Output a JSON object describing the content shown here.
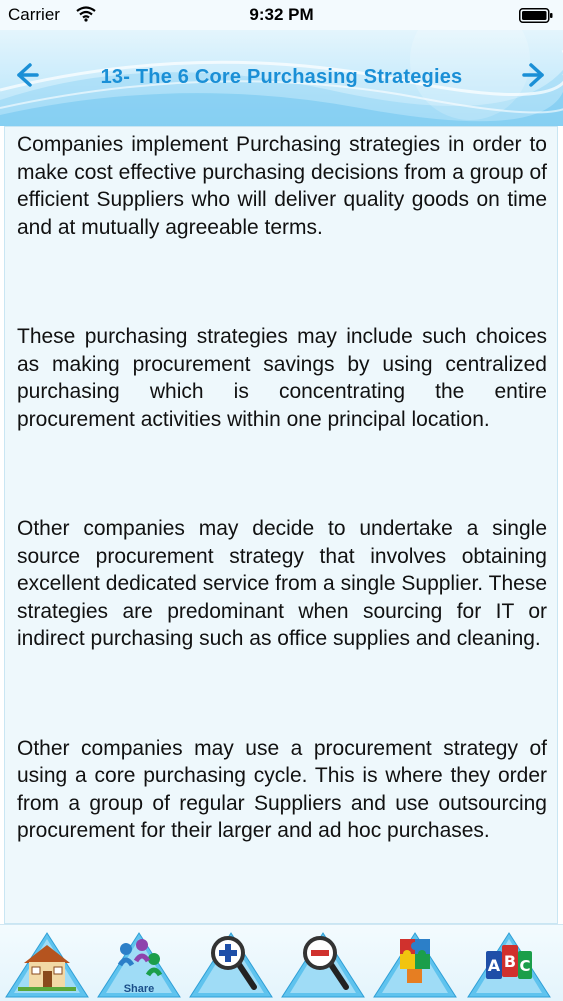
{
  "status_bar": {
    "carrier": "Carrier",
    "time": "9:32 PM"
  },
  "header": {
    "title": "13- The 6 Core Purchasing Strategies",
    "back_icon": "chevron-left-icon",
    "forward_icon": "chevron-right-icon"
  },
  "content": {
    "paragraphs": [
      "Companies implement Purchasing strategies in order to make cost effective purchasing decisions from a group of efficient Suppliers who will deliver quality goods on time and at mutually agreeable terms.",
      "These purchasing strategies may include such choices as making procurement savings by using centralized purchasing which is concentrating the entire procurement activities within one principal location.",
      "Other companies may decide to undertake a single source procurement strategy that involves obtaining excellent dedicated service from a single Supplier. These strategies are predominant when sourcing for IT or indirect purchasing such as office supplies and cleaning.",
      "Other companies may use a procurement strategy of using a core purchasing cycle. This is where they order from a group of regular Suppliers and use outsourcing procurement for their larger and ad hoc purchases."
    ]
  },
  "toolbar": {
    "items": [
      {
        "icon": "home-icon",
        "label": ""
      },
      {
        "icon": "share-icon",
        "label": "Share"
      },
      {
        "icon": "zoom-in-icon",
        "label": ""
      },
      {
        "icon": "zoom-out-icon",
        "label": ""
      },
      {
        "icon": "puzzle-icon",
        "label": ""
      },
      {
        "icon": "abc-blocks-icon",
        "label": ""
      }
    ]
  },
  "colors": {
    "title": "#1a8fd6",
    "content_bg": "#eef8fc",
    "header_bg": "#c9ebfb",
    "toolbar_triangle": "#5fc3ee"
  }
}
